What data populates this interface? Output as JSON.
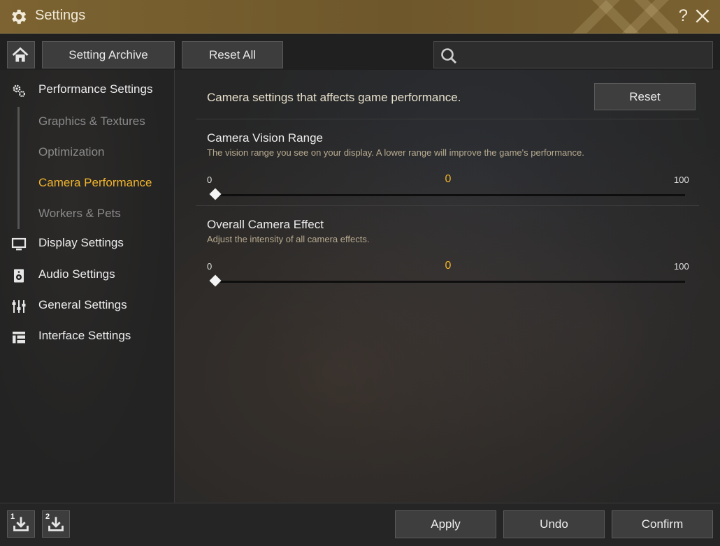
{
  "window": {
    "title": "Settings"
  },
  "toolbar": {
    "setting_archive_label": "Setting Archive",
    "reset_all_label": "Reset All",
    "search_value": "",
    "search_placeholder": ""
  },
  "sidebar": {
    "sections": [
      {
        "label": "Performance Settings",
        "icon": "gears-icon"
      },
      {
        "label": "Display Settings",
        "icon": "monitor-icon"
      },
      {
        "label": "Audio Settings",
        "icon": "speaker-icon"
      },
      {
        "label": "General Settings",
        "icon": "sliders-icon"
      },
      {
        "label": "Interface Settings",
        "icon": "layout-icon"
      }
    ],
    "sub_items": [
      {
        "label": "Graphics & Textures",
        "active": false
      },
      {
        "label": "Optimization",
        "active": false
      },
      {
        "label": "Camera Performance",
        "active": true
      },
      {
        "label": "Workers & Pets",
        "active": false
      }
    ]
  },
  "content": {
    "header": "Camera settings that affects game performance.",
    "reset_label": "Reset",
    "settings": [
      {
        "title": "Camera Vision Range",
        "description": "The vision range you see on your display. A lower range will improve the game's performance.",
        "min": "0",
        "max": "100",
        "value": "0"
      },
      {
        "title": "Overall Camera Effect",
        "description": "Adjust the intensity of all camera effects.",
        "min": "0",
        "max": "100",
        "value": "0"
      }
    ]
  },
  "bottom": {
    "preset1_num": "1",
    "preset2_num": "2",
    "apply_label": "Apply",
    "undo_label": "Undo",
    "confirm_label": "Confirm"
  },
  "colors": {
    "accent": "#f0b32c",
    "titlebar": "#7c6331",
    "panel": "#202020"
  }
}
